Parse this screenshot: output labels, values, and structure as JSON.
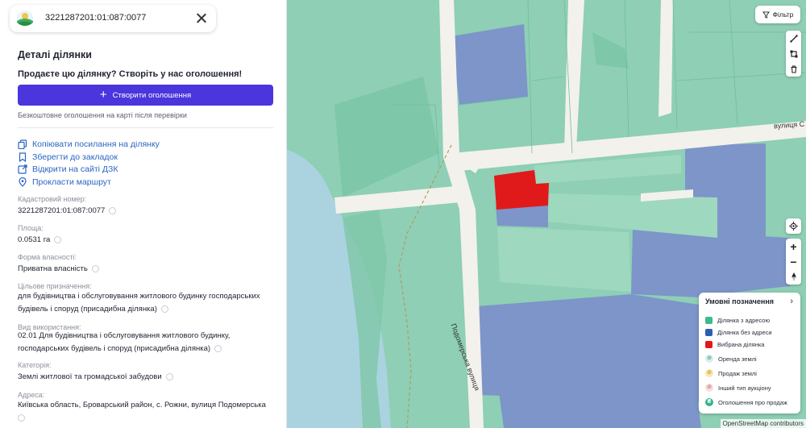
{
  "search": {
    "value": "3221287201:01:087:0077"
  },
  "details": {
    "title": "Деталі ділянки",
    "sell_question": "Продаєте цю ділянку? Створіть у нас оголошення!",
    "create_button": "Створити оголошення",
    "free_note": "Безкоштовне оголошення на карті після перевірки"
  },
  "actions": {
    "copy_link": "Копіювати посилання на ділянку",
    "bookmark": "Зберегти до закладок",
    "open_dzk": "Відкрити на сайті ДЗК",
    "route": "Прокласти маршрут"
  },
  "fields": {
    "cadastral_label": "Кадастровий номер:",
    "cadastral_value": "3221287201:01:087:0077",
    "area_label": "Площа:",
    "area_value": "0.0531 га",
    "ownership_label": "Форма власності:",
    "ownership_value": "Приватна власність",
    "purpose_label": "Цільове призначення:",
    "purpose_line1": "для будівництва і обслуговування житлового будинку господарських",
    "purpose_line2": "будівель і споруд (присадибна ділянка)",
    "usage_label": "Вид використання:",
    "usage_line1": "02.01 Для будівництва і обслуговування житлового будинку,",
    "usage_line2": "господарських будівель і споруд (присадибна ділянка)",
    "category_label": "Категорія:",
    "category_value": "Землі житлової та громадської забудови",
    "address_label": "Адреса:",
    "address_value": "Київська область, Броварський район, с. Рожни, вулиця Подомерська"
  },
  "map": {
    "filter_label": "Фільтр",
    "street_main": "Подомерська вулиця",
    "street_top": "вулиця С",
    "attribution": "OpenStreetMap contributors"
  },
  "legend": {
    "title": "Умовні позначення",
    "items": [
      {
        "label": "Ділянка з адресою",
        "color": "#3dbb8f"
      },
      {
        "label": "Ділянка без адреси",
        "color": "#2d5fb0"
      },
      {
        "label": "Вибрана ділянка",
        "color": "#e01a1a"
      },
      {
        "label": "Оренда землі",
        "icon": "rent-icon",
        "color": "#8fd3c6"
      },
      {
        "label": "Продаж землі",
        "icon": "sale-icon",
        "color": "#f2b630"
      },
      {
        "label": "Інший тип аукціону",
        "icon": "auction-icon",
        "color": "#e4a9a9"
      },
      {
        "label": "Оголошення про продаж",
        "icon": "listing-icon",
        "color": "#2fb58a"
      }
    ]
  },
  "colors": {
    "accent": "#4a36dc",
    "link": "#2a65c4",
    "parcel_with_address": "#8ecfb5",
    "parcel_without_address": "#7d95c9",
    "selected_parcel": "#e01a1a",
    "water": "#aad3df"
  }
}
